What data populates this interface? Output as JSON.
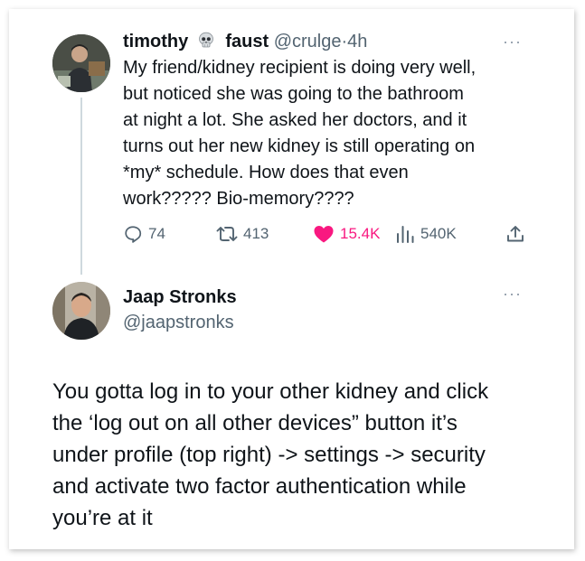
{
  "tweet1": {
    "display_name_first": "timothy",
    "display_name_last": "faust",
    "name_emoji": "skull-icon",
    "handle": "@crulge",
    "separator": "·",
    "time": "4h",
    "more": "···",
    "body_lines": [
      "My friend/kidney recipient is doing very well,",
      "but noticed she was going to the bathroom",
      "at night a lot. She asked her doctors, and it",
      "turns out her new kidney is still operating on",
      "*my* schedule. How does that even",
      "work????? Bio-memory????"
    ],
    "actions": {
      "replies": "74",
      "retweets": "413",
      "likes": "15.4K",
      "views": "540K"
    },
    "like_color": "#f91880"
  },
  "tweet2": {
    "display_name": "Jaap Stronks",
    "handle": "@jaapstronks",
    "more": "···",
    "body_lines": [
      "You gotta log in to your other kidney and click",
      "the ‘log out on all other devices” button it’s",
      "under profile (top right) -> settings -> security",
      "and activate two factor authentication while",
      "you’re at it"
    ]
  },
  "colors": {
    "text": "#0f1419",
    "secondary": "#536471",
    "thread_line": "#cfd9de"
  }
}
